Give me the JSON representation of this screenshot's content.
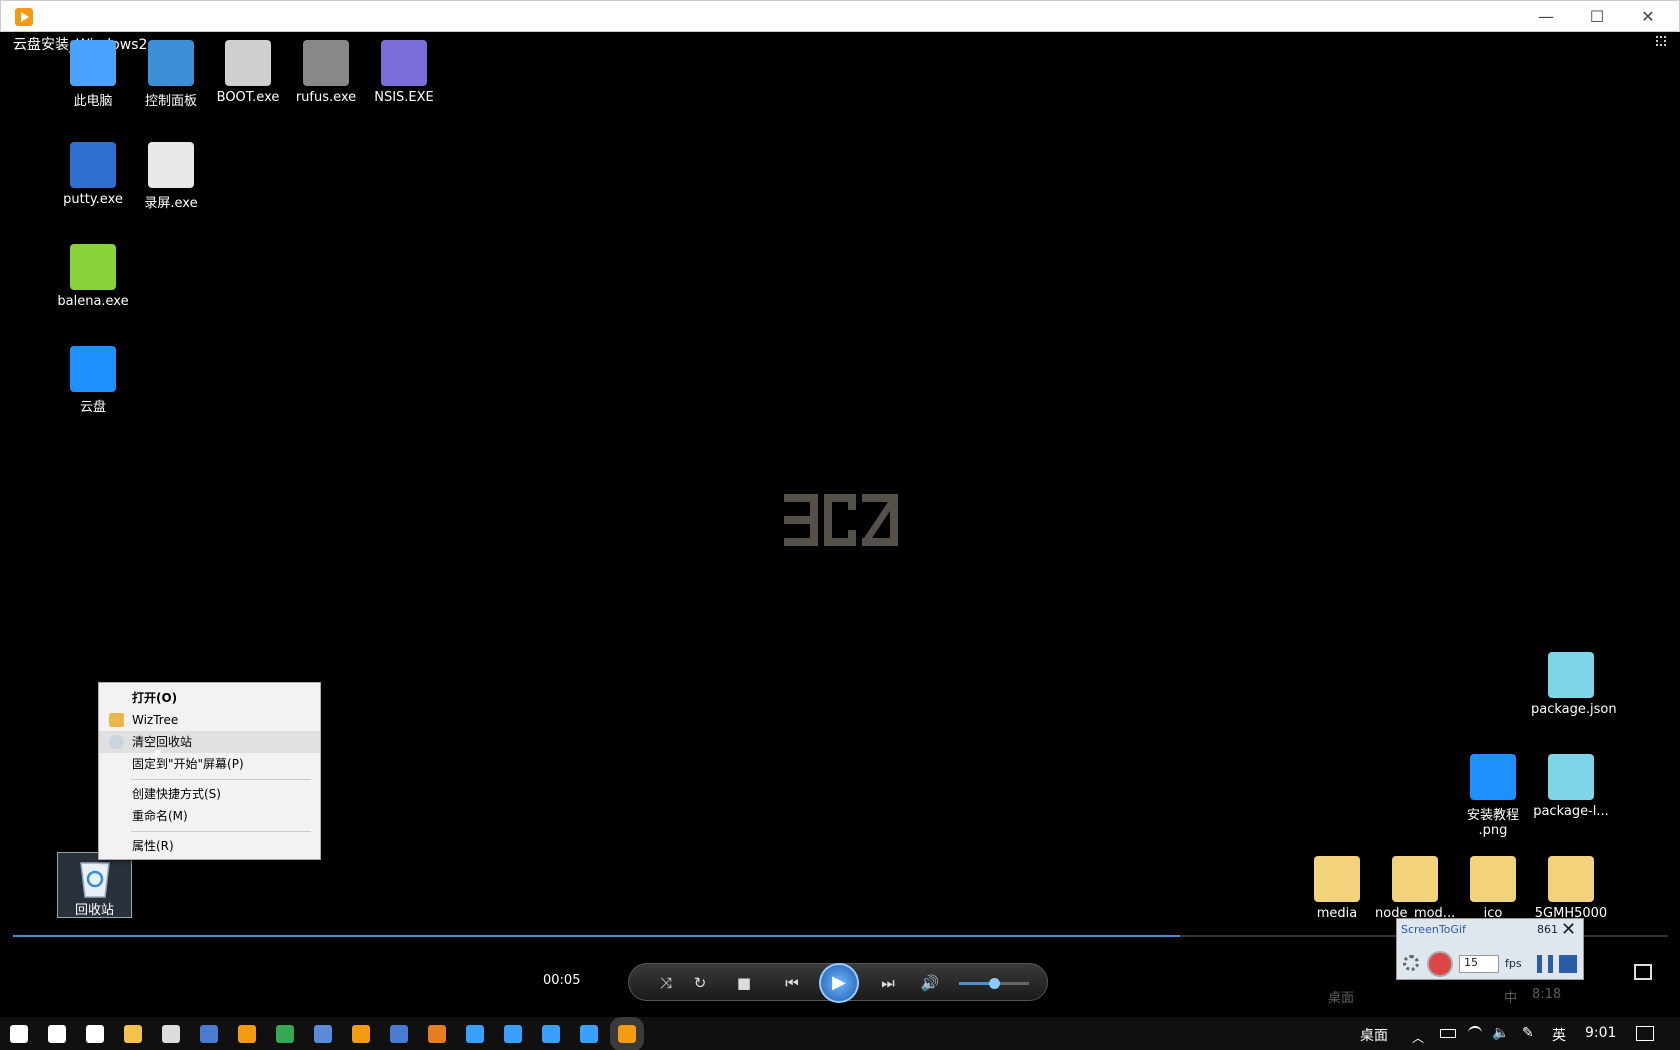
{
  "window": {
    "minimize": "—",
    "maximize": "☐",
    "close": "✕"
  },
  "video_title": "云盘安装_Windows2",
  "desktop_icons_left": [
    {
      "label": "此电脑",
      "icon": "computer-icon",
      "color": "#4aa3ff"
    },
    {
      "label": "控制面板",
      "icon": "control-panel-icon",
      "color": "#3b8fd6"
    },
    {
      "label": "BOOT.exe",
      "icon": "boot-icon",
      "color": "#cfcfcf"
    },
    {
      "label": "rufus.exe",
      "icon": "usb-icon",
      "color": "#888888"
    },
    {
      "label": "NSIS.EXE",
      "icon": "nsis-icon",
      "color": "#7a6fd8"
    },
    {
      "label": "putty.exe",
      "icon": "putty-icon",
      "color": "#2f6fd0"
    },
    {
      "label": "录屏.exe",
      "icon": "recorder-icon",
      "color": "#e8e8e8"
    },
    {
      "label": "balena.exe",
      "icon": "balena-icon",
      "color": "#8bd13c"
    },
    {
      "label": "云盘",
      "icon": "cloud-drive-icon",
      "color": "#1e90ff"
    }
  ],
  "context_menu": {
    "items": [
      "打开(O)",
      "WizTree",
      "清空回收站",
      "固定到\"开始\"屏幕(P)",
      "创建快捷方式(S)",
      "重命名(M)",
      "属性(R)"
    ]
  },
  "recycle_bin": {
    "label": "回收站"
  },
  "desktop_icons_right": [
    {
      "label": "package.json",
      "icon": "json-file-icon",
      "color": "#7fd4e8"
    },
    {
      "label": "安装教程\n.png",
      "icon": "image-file-icon",
      "color": "#1e90ff"
    },
    {
      "label": "package-l...",
      "icon": "json-file-icon",
      "color": "#7fd4e8"
    },
    {
      "label": "media",
      "icon": "folder-icon",
      "color": "#f2d27a"
    },
    {
      "label": "node_mod...",
      "icon": "folder-icon",
      "color": "#f2d27a"
    },
    {
      "label": "ico",
      "icon": "folder-icon",
      "color": "#f2d27a"
    },
    {
      "label": "5GMH5000",
      "icon": "folder-icon",
      "color": "#f2d27a"
    }
  ],
  "player": {
    "time": "00:05",
    "progress_fraction": 0.705,
    "volume_fraction": 0.5
  },
  "screentogif": {
    "title": "ScreenToGif",
    "count": "861",
    "fps_value": "15",
    "fps_label": "fps"
  },
  "faint_tray": {
    "desktop": "桌面",
    "ime": "中",
    "time": "8:18"
  },
  "taskbar": {
    "desktop_label": "桌面",
    "ime_label": "英",
    "clock": "9:01",
    "icons": [
      {
        "name": "start-icon",
        "color": "#ffffff"
      },
      {
        "name": "search-icon",
        "color": "#ffffff"
      },
      {
        "name": "task-view-icon",
        "color": "#ffffff"
      },
      {
        "name": "file-explorer-icon",
        "color": "#f2c14e"
      },
      {
        "name": "terminal-icon",
        "color": "#dddddd"
      },
      {
        "name": "remote-icon",
        "color": "#4a7bd0"
      },
      {
        "name": "app-orange-icon",
        "color": "#f39c12"
      },
      {
        "name": "chrome-icon",
        "color": "#34a853"
      },
      {
        "name": "app-cube-icon",
        "color": "#5a8ad8"
      },
      {
        "name": "app-ring-icon",
        "color": "#f39c12"
      },
      {
        "name": "putty-icon",
        "color": "#4a7bd0"
      },
      {
        "name": "app-s-icon",
        "color": "#e67e22"
      },
      {
        "name": "search-app-icon",
        "color": "#3aa0ff"
      },
      {
        "name": "server-icon",
        "color": "#3aa0ff"
      },
      {
        "name": "network-icon",
        "color": "#3aa0ff"
      },
      {
        "name": "cloud-drive-icon",
        "color": "#3aa0ff"
      },
      {
        "name": "player-icon",
        "color": "#f39c12"
      }
    ]
  }
}
